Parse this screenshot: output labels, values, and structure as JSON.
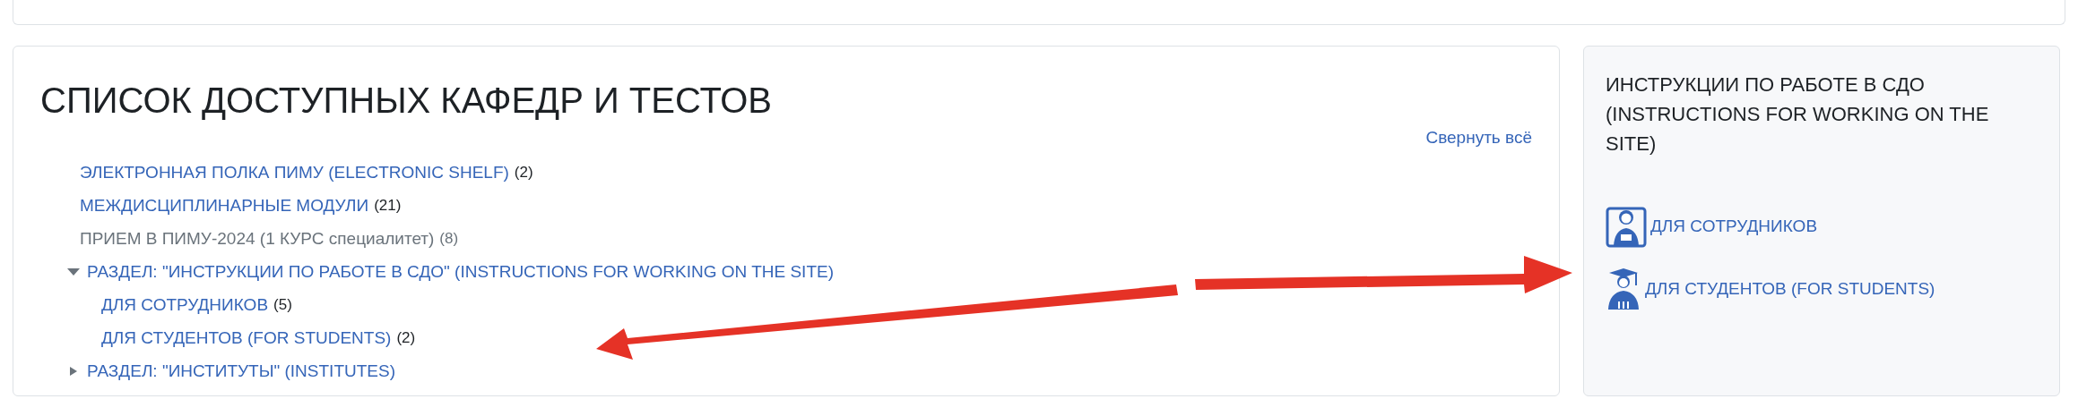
{
  "main": {
    "title": "СПИСОК ДОСТУПНЫХ КАФЕДР И ТЕСТОВ",
    "collapse_all": "Свернуть всё",
    "categories": [
      {
        "name": "ЭЛЕКТРОННАЯ ПОЛКА ПИМУ (ELECTRONIC SHELF)",
        "count": "(2)",
        "dimmed": false
      },
      {
        "name": "МЕЖДИСЦИПЛИНАРНЫЕ МОДУЛИ",
        "count": "(21)",
        "dimmed": false
      },
      {
        "name": "ПРИЕМ В ПИМУ-2024 (1 КУРС специалитет)",
        "count": "(8)",
        "dimmed": true
      },
      {
        "name": "РАЗДЕЛ: \"ИНСТРУКЦИИ ПО РАБОТЕ В СДО\" (INSTRUCTIONS FOR WORKING ON THE SITE)",
        "dimmed": false,
        "expanded": true,
        "children": [
          {
            "name": "ДЛЯ СОТРУДНИКОВ",
            "count": "(5)",
            "dimmed": false
          },
          {
            "name": "ДЛЯ СТУДЕНТОВ (FOR STUDENTS)",
            "count": "(2)",
            "dimmed": false
          }
        ]
      },
      {
        "name": "РАЗДЕЛ: \"ИНСТИТУТЫ\" (INSTITUTES)",
        "dimmed": false,
        "expanded": false
      }
    ]
  },
  "sidebar": {
    "title": "ИНСТРУКЦИИ ПО РАБОТЕ В СДО (INSTRUCTIONS FOR WORKING ON THE SITE)",
    "links": [
      {
        "label": "ДЛЯ СОТРУДНИКОВ",
        "kind": "staff"
      },
      {
        "label": "ДЛЯ СТУДЕНТОВ (FOR STUDENTS)",
        "kind": "student"
      }
    ]
  }
}
